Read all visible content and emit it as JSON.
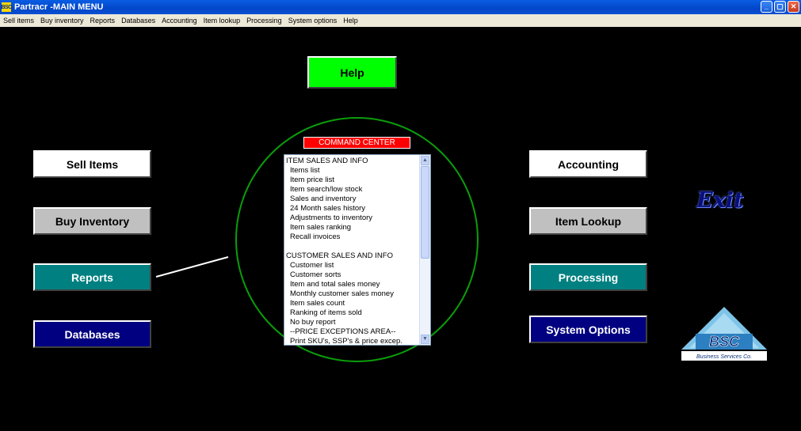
{
  "window": {
    "icon_text": "BSC",
    "title": "Partracr -MAIN MENU",
    "minimize": "_",
    "maximize": "▢",
    "close": "✕"
  },
  "menu": [
    "Sell items",
    "Buy inventory",
    "Reports",
    "Databases",
    "Accounting",
    "Item lookup",
    "Processing",
    "System options",
    "Help"
  ],
  "buttons": {
    "help": "Help",
    "sell_items": "Sell Items",
    "buy_inventory": "Buy Inventory",
    "reports": "Reports",
    "databases": "Databases",
    "accounting": "Accounting",
    "item_lookup": "Item Lookup",
    "processing": "Processing",
    "system_options": "System Options",
    "exit": "Exit"
  },
  "command_center": {
    "label": "COMMAND CENTER",
    "items": [
      {
        "text": "ITEM SALES AND INFO",
        "sub": false
      },
      {
        "text": "Items list",
        "sub": true
      },
      {
        "text": "Item price list",
        "sub": true
      },
      {
        "text": "Item search/low stock",
        "sub": true
      },
      {
        "text": "Sales and inventory",
        "sub": true
      },
      {
        "text": "24 Month sales history",
        "sub": true
      },
      {
        "text": "Adjustments to inventory",
        "sub": true
      },
      {
        "text": "Item sales ranking",
        "sub": true
      },
      {
        "text": "Recall invoices",
        "sub": true
      },
      {
        "text": "",
        "sub": false
      },
      {
        "text": "CUSTOMER SALES AND INFO",
        "sub": false
      },
      {
        "text": "Customer list",
        "sub": true
      },
      {
        "text": "Customer sorts",
        "sub": true
      },
      {
        "text": "Item and total sales money",
        "sub": true
      },
      {
        "text": "Monthly customer sales money",
        "sub": true
      },
      {
        "text": "Item sales count",
        "sub": true
      },
      {
        "text": "Ranking of items sold",
        "sub": true
      },
      {
        "text": "No buy report",
        "sub": true
      },
      {
        "text": "--PRICE EXCEPTIONS AREA--",
        "sub": true
      },
      {
        "text": "Print SKU's, SSP's & price excep.",
        "sub": true
      }
    ]
  },
  "logo": {
    "text": "BSC",
    "tagline": "Business Services Co."
  },
  "colors": {
    "help_green": "#00ff00",
    "reports_teal": "#008080",
    "databases_navy": "#000080",
    "command_red": "#ff0000",
    "circle_green": "#0a9d0a"
  }
}
